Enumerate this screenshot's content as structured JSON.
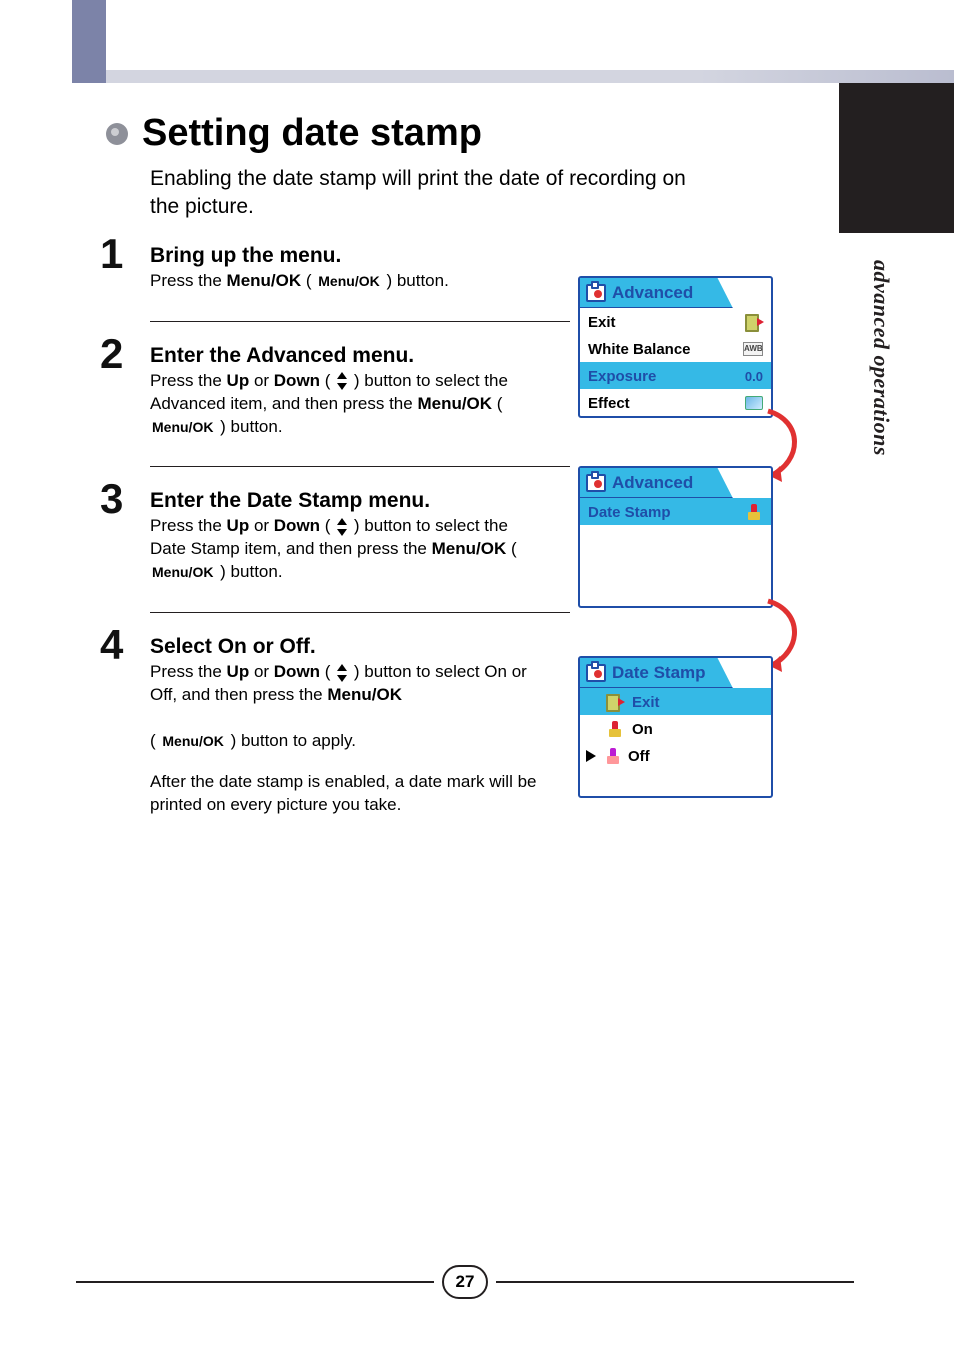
{
  "side_tab": "advanced operations",
  "title": "Setting date stamp",
  "intro": "Enabling the date stamp will print the date of recording on the picture.",
  "menuok_label": "Menu/OK",
  "steps": [
    {
      "num": "1",
      "head": "Bring up the menu.",
      "body_pre": "Press the ",
      "body_bold1": "Menu/OK",
      "body_mid1": " ( ",
      "body_mid2": " ) button.",
      "has_updown": false
    },
    {
      "num": "2",
      "head": "Enter the Advanced menu.",
      "body_pre": "Press the ",
      "body_bold1": "Up",
      "body_mid1": " or ",
      "body_bold2": "Down",
      "body_mid2": " ( ",
      "body_mid3": " ) button to select the Advanced item, and then press the ",
      "body_bold3": "Menu/OK",
      "body_mid4": " ( ",
      "body_mid5": " ) button.",
      "has_updown": true
    },
    {
      "num": "3",
      "head": "Enter the Date Stamp menu.",
      "body_pre": "Press the ",
      "body_bold1": "Up",
      "body_mid1": " or ",
      "body_bold2": "Down",
      "body_mid2": " ( ",
      "body_mid3": " ) button to select the Date Stamp item, and then press the ",
      "body_bold3": "Menu/OK",
      "body_mid4": " ( ",
      "body_mid5": " ) button.",
      "has_updown": true
    },
    {
      "num": "4",
      "head": "Select On or Off.",
      "body_pre": "Press the ",
      "body_bold1": "Up",
      "body_mid1": " or ",
      "body_bold2": "Down",
      "body_mid2": " ( ",
      "body_mid3": " ) button to select On or Off, and then press the ",
      "body_bold3": "Menu/OK",
      "body_mid4": "\n( ",
      "body_mid5": " ) button to apply.",
      "body_after": "After the date stamp is enabled, a date mark will be printed on every picture you take.",
      "has_updown": true
    }
  ],
  "panels": {
    "p1": {
      "title": "Advanced",
      "rows": [
        {
          "label": "Exit",
          "icon": "exit",
          "sel": false
        },
        {
          "label": "White Balance",
          "icon": "awb",
          "awb_text": "AWB",
          "sel": false
        },
        {
          "label": "Exposure",
          "value": "0.0",
          "sel": true
        },
        {
          "label": "Effect",
          "icon": "effect",
          "sel": false
        }
      ]
    },
    "p2": {
      "title": "Advanced",
      "rows": [
        {
          "label": "Date Stamp",
          "icon": "stamp",
          "sel": true
        }
      ],
      "padding_rows": 3
    },
    "p3": {
      "title": "Date Stamp",
      "rows": [
        {
          "label": "Exit",
          "lefticon": "exit",
          "sel": true,
          "indicator": false
        },
        {
          "label": "On",
          "lefticon": "stamp",
          "sel": false,
          "indicator": false
        },
        {
          "label": "Off",
          "lefticon": "stamp-off",
          "sel": false,
          "indicator": true
        }
      ]
    }
  },
  "page_number": "27"
}
